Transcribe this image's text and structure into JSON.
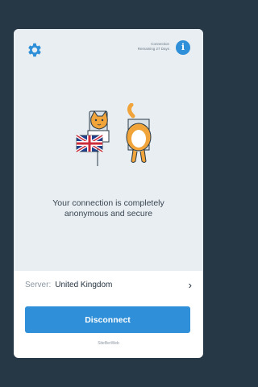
{
  "header": {
    "settings_icon": "gear-icon",
    "status_line1": "Connection",
    "status_line2": "Remaining 27 Days",
    "info_icon": "info-icon",
    "info_glyph": "i"
  },
  "main": {
    "message": "Your connection is completely anonymous and secure"
  },
  "server": {
    "label": "Server:",
    "value": "United Kingdom",
    "chevron": "›"
  },
  "actions": {
    "disconnect_label": "Disconnect"
  },
  "footer": {
    "text": "SiteBerWeb"
  },
  "colors": {
    "background": "#263746",
    "accent": "#2f8fd8",
    "card": "#ffffff",
    "panel": "#e8eef2"
  }
}
